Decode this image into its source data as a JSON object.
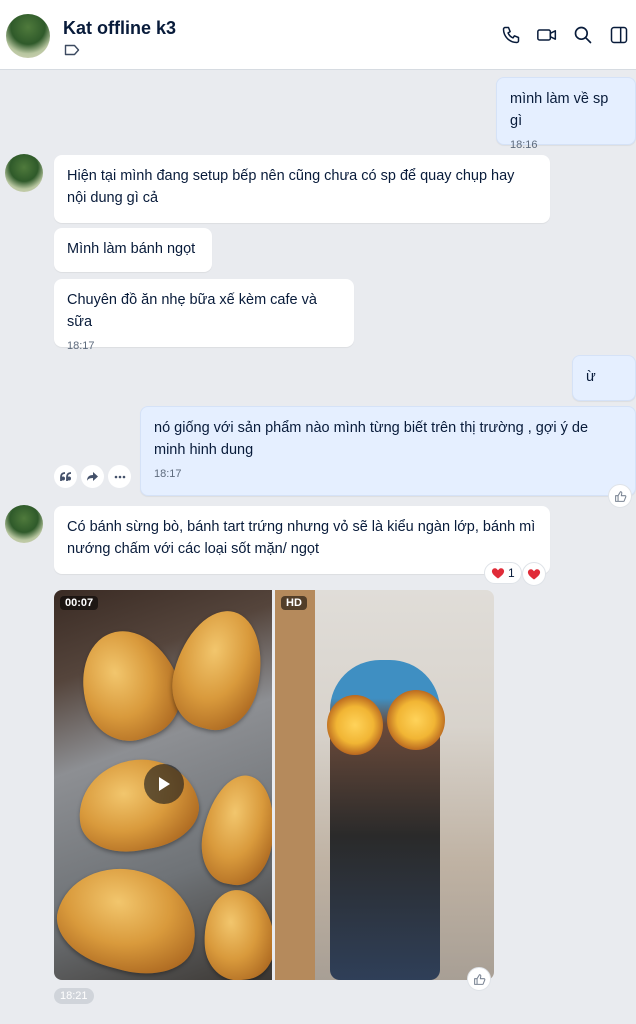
{
  "header": {
    "title": "Kat offline k3",
    "icons": [
      "phone-icon",
      "video-call-icon",
      "search-icon",
      "sidebar-toggle-icon"
    ]
  },
  "messages": [
    {
      "from": "me",
      "text": "mình làm về sp gì",
      "time": "18:16"
    },
    {
      "from": "them",
      "text": "Hiện tại mình đang setup bếp nên cũng chưa có sp để quay chụp hay nội dung gì cả"
    },
    {
      "from": "them",
      "text": "Mình làm bánh ngọt"
    },
    {
      "from": "them",
      "text": "Chuyên đồ ăn nhẹ bữa xế kèm cafe và sữa",
      "time": "18:17"
    },
    {
      "from": "me",
      "text": "ừ"
    },
    {
      "from": "me",
      "text": "nó giống với sản phẩm nào mình từng biết trên thị trường , gợi ý de minh hinh dung",
      "time": "18:17"
    },
    {
      "from": "them",
      "text": "Có bánh sừng bò, bánh tart trứng nhưng vỏ sẽ là kiểu ngàn lớp, bánh mì nướng chấm với các loại sốt mặn/ ngọt",
      "reaction_count": "1"
    }
  ],
  "media": {
    "video_duration": "00:07",
    "hd_label": "HD",
    "time": "18:21"
  }
}
